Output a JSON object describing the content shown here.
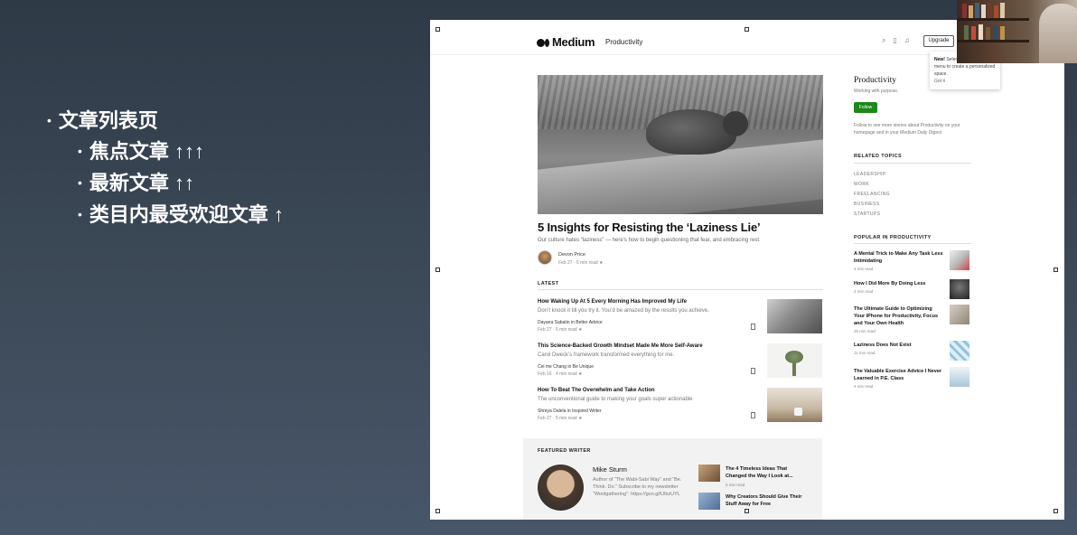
{
  "slide": {
    "outline": [
      {
        "level": 1,
        "text": "文章列表页"
      },
      {
        "level": 2,
        "text": "焦点文章 ↑↑↑"
      },
      {
        "level": 2,
        "text": "最新文章 ↑↑"
      },
      {
        "level": 2,
        "text": "类目内最受欢迎文章 ↑"
      }
    ]
  },
  "header": {
    "logo": "Medium",
    "publication": "Productivity",
    "upgrade_label": "Upgrade"
  },
  "tooltip": {
    "bold": "New!",
    "text": "Select ... profile\" in the menu to create a personalized space.",
    "got_it": "Got it"
  },
  "hero": {
    "title": "5 Insights for Resisting the ‘Laziness Lie’",
    "subtitle": "Our culture hates “laziness” — here’s how to begin questioning that fear, and embracing rest.",
    "author": "Devon Price",
    "meta": "Feb 27 · 6 min read ★"
  },
  "latest": {
    "label": "LATEST",
    "posts": [
      {
        "title": "How Waking Up At 5 Every Morning Has Improved My Life",
        "subtitle": "Don’t knock it till you try it. You’d be amazed by the results you achieve.",
        "author": "Dayana Sabatin in Better Advice",
        "meta": "Feb 27 · 5 min read ★"
      },
      {
        "title": "This Science-Backed Growth Mindset Made Me More Self-Aware",
        "subtitle": "Carol Dweck’s framework transformed everything for me.",
        "author": "Cel me Chang in Be Unique",
        "meta": "Feb 16 · 4 min read ★"
      },
      {
        "title": "How To Beat The Overwhelm and Take Action",
        "subtitle": "The unconventional guide to making your goals super actionable",
        "author": "Shreya Dalela in Inspired Writer",
        "meta": "Feb 27 · 5 min read ★"
      }
    ]
  },
  "sidebar": {
    "title": "Productivity",
    "tagline": "Working with purpose.",
    "follow_label": "Follow",
    "description": "Follow to see more stories about Productivity on your homepage and in your Medium Daily Digest",
    "related_label": "RELATED TOPICS",
    "topics": [
      "LEADERSHIP",
      "WORK",
      "FREELANCING",
      "BUSINESS",
      "STARTUPS"
    ],
    "popular_label": "POPULAR IN PRODUCTIVITY",
    "popular": [
      {
        "title": "A Mental Trick to Make Any Task Less Intimidating",
        "meta": "4 min read"
      },
      {
        "title": "How I Did More By Doing Less",
        "meta": "4 min read"
      },
      {
        "title": "The Ultimate Guide to Optimizing Your iPhone for Productivity, Focus and Your Own Health",
        "meta": "25 min read"
      },
      {
        "title": "Laziness Does Not Exist",
        "meta": "11 min read"
      },
      {
        "title": "The Valuable Exercise Advice I Never Learned in P.E. Class",
        "meta": "4 min read"
      }
    ]
  },
  "featured": {
    "label": "FEATURED WRITER",
    "name": "Mike Sturm",
    "bio": "Author of “The Wabi-Sabi Way” and “Be. Think. Do.” Subscribe to my newsletter “Woolgathering”: https://goo.gl/UfszUYL",
    "articles": [
      {
        "title": "The 4 Timeless Ideas That Changed the Way I Look at...",
        "meta": "6 min read"
      },
      {
        "title": "Why Creators Should Give Their Stuff Away for Free",
        "meta": ""
      }
    ]
  },
  "colors": {
    "follow_green": "#1a8917",
    "background": "#3d4a58"
  }
}
